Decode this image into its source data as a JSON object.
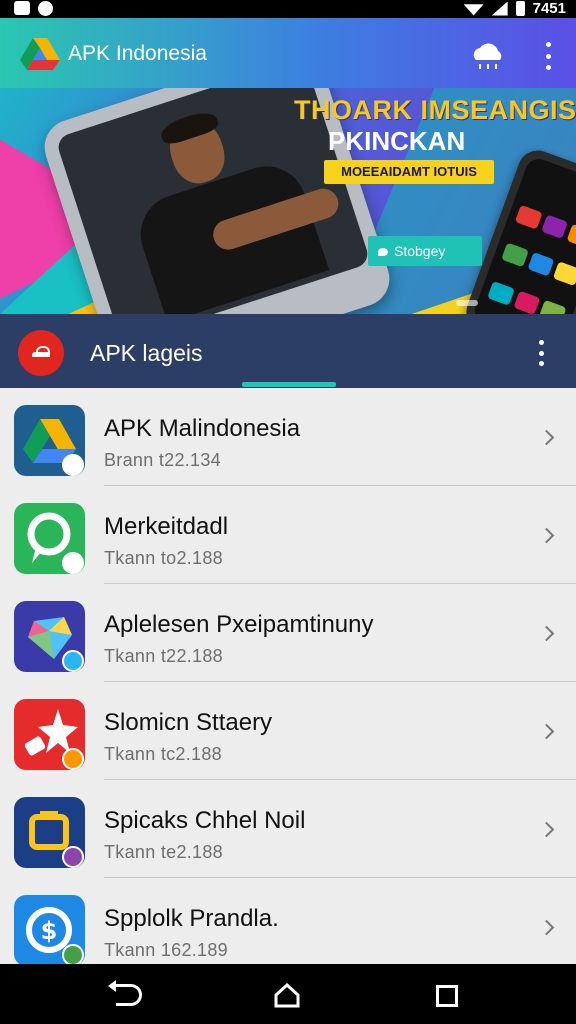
{
  "status_bar": {
    "time": "7451"
  },
  "app_bar": {
    "title": "APK Indonesia",
    "brand_color": "#3d7fe0"
  },
  "banner": {
    "headline": "THOARK IMSEANGIS",
    "subheadline": "PKINCKAN",
    "tag": "MOEEAIDAMT IOTUIS",
    "button_label": "Stobgey"
  },
  "section": {
    "title": "APK lageis"
  },
  "apps": [
    {
      "name": "APK Malindonesia",
      "subtitle": "Brann t22.134",
      "icon": "drive-icon",
      "color": "#1f5f8f"
    },
    {
      "name": "Merkeitdadl",
      "subtitle": "Tkann to2.188",
      "icon": "maps-pin-icon",
      "color": "#2bb55a"
    },
    {
      "name": "Aplelesen Pxeipamtinuny",
      "subtitle": "Tkann t22.188",
      "icon": "crystal-icon",
      "color": "#3a3aa8"
    },
    {
      "name": "Slomicn Sttaery",
      "subtitle": "Tkann tc2.188",
      "icon": "star-tag-icon",
      "color": "#e52b2b"
    },
    {
      "name": "Spicaks Chhel Noil",
      "subtitle": "Tkann te2.188",
      "icon": "wallet-icon",
      "color": "#1b3e86"
    },
    {
      "name": "Spplolk Prandla.",
      "subtitle": "Tkann 162.189",
      "icon": "dollar-coin-icon",
      "color": "#1e88e5"
    }
  ]
}
